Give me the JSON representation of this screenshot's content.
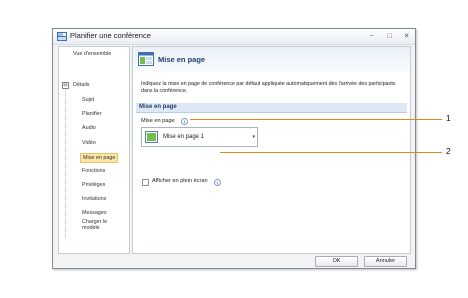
{
  "window": {
    "title": "Planifier une conférence",
    "controls": [
      "−",
      "□",
      "✕"
    ]
  },
  "sidebar": {
    "items": [
      {
        "label": "Vue d'ensemble"
      },
      {
        "label": "Détails"
      },
      {
        "label": "Sujet"
      },
      {
        "label": "Planifier"
      },
      {
        "label": "Audio"
      },
      {
        "label": "Vidéo"
      },
      {
        "label": "Mise en page",
        "selected": true
      },
      {
        "label": "Fonctions"
      },
      {
        "label": "Privilèges"
      },
      {
        "label": "Invitations"
      },
      {
        "label": "Messages"
      },
      {
        "label": "Charger le modèle"
      }
    ],
    "expander": "⊟"
  },
  "content": {
    "title": "Mise en page",
    "description": "Indiquez la mise en page de conférence par défaut appliquée automatiquement dès l'arrivée des participants dans la conférence.",
    "section_title": "Mise en page",
    "layout_label": "Mise en page",
    "layout_value": "Mise en page 1",
    "fullscreen_label": "Afficher en plein écran",
    "fullscreen_checked": false,
    "info_glyph": "i"
  },
  "footer": {
    "ok_label": "OK",
    "cancel_label": "Annuler"
  },
  "callouts": [
    "1",
    "2"
  ],
  "colors": {
    "accent": "#1f3f6e",
    "selection": "#fbe6a3",
    "callout_line": "#e08a1e"
  }
}
